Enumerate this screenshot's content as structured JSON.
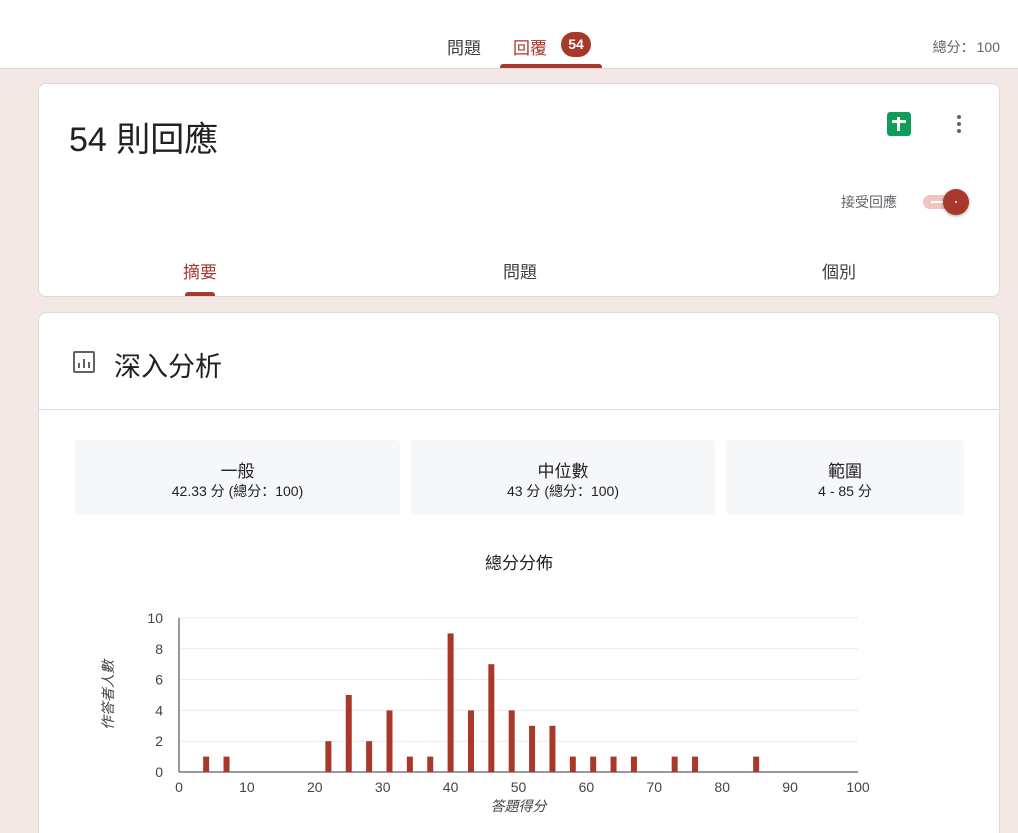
{
  "header": {
    "tabs": [
      {
        "label": "問題"
      },
      {
        "label": "回覆",
        "badge": "54"
      }
    ],
    "total_points_label": "總分：",
    "total_points_value": "100"
  },
  "responses_card": {
    "title": "54 則回應",
    "sheets_icon": "google-sheets-icon",
    "more_icon": "more-vert-icon",
    "accepting_label": "接受回應",
    "accepting_on": true,
    "tabs": [
      {
        "label": "摘要",
        "active": true
      },
      {
        "label": "問題",
        "active": false
      },
      {
        "label": "個別",
        "active": false
      }
    ]
  },
  "insights": {
    "icon": "bar-chart-icon",
    "title": "深入分析",
    "stats": [
      {
        "label": "一般",
        "value": "42.33 分 (總分：100)"
      },
      {
        "label": "中位數",
        "value": "43 分 (總分：100)"
      },
      {
        "label": "範圍",
        "value": "4 - 85 分"
      }
    ]
  },
  "colors": {
    "accent": "#a8382a",
    "sheets_green": "#0f9d58",
    "page_background": "#f4e8e6"
  },
  "chart_data": {
    "type": "bar",
    "title": "總分分佈",
    "xlabel": "答題得分",
    "ylabel": "作答者人數",
    "xlim": [
      0,
      100
    ],
    "ylim": [
      0,
      10
    ],
    "x_ticks": [
      0,
      10,
      20,
      30,
      40,
      50,
      60,
      70,
      80,
      90,
      100
    ],
    "y_ticks": [
      0,
      2,
      4,
      6,
      8,
      10
    ],
    "grid": true,
    "color": "#a8382a",
    "x": [
      4,
      7,
      22,
      25,
      28,
      31,
      34,
      37,
      40,
      43,
      46,
      49,
      52,
      55,
      58,
      61,
      64,
      67,
      73,
      76,
      85
    ],
    "values": [
      1,
      1,
      2,
      5,
      2,
      4,
      1,
      1,
      9,
      4,
      7,
      4,
      3,
      3,
      1,
      1,
      1,
      1,
      1,
      1,
      1
    ]
  }
}
